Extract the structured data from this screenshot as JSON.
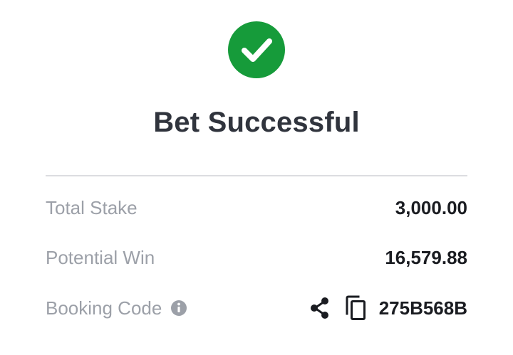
{
  "status": {
    "icon": "check-circle-icon",
    "title": "Bet Successful",
    "color": "#169b3a"
  },
  "summary": {
    "total_stake_label": "Total Stake",
    "total_stake_value": "3,000.00",
    "potential_win_label": "Potential Win",
    "potential_win_value": "16,579.88",
    "booking_code_label": "Booking Code",
    "booking_code_value": "275B568B",
    "info_icon": "info-icon",
    "share_icon": "share-icon",
    "copy_icon": "copy-icon"
  }
}
